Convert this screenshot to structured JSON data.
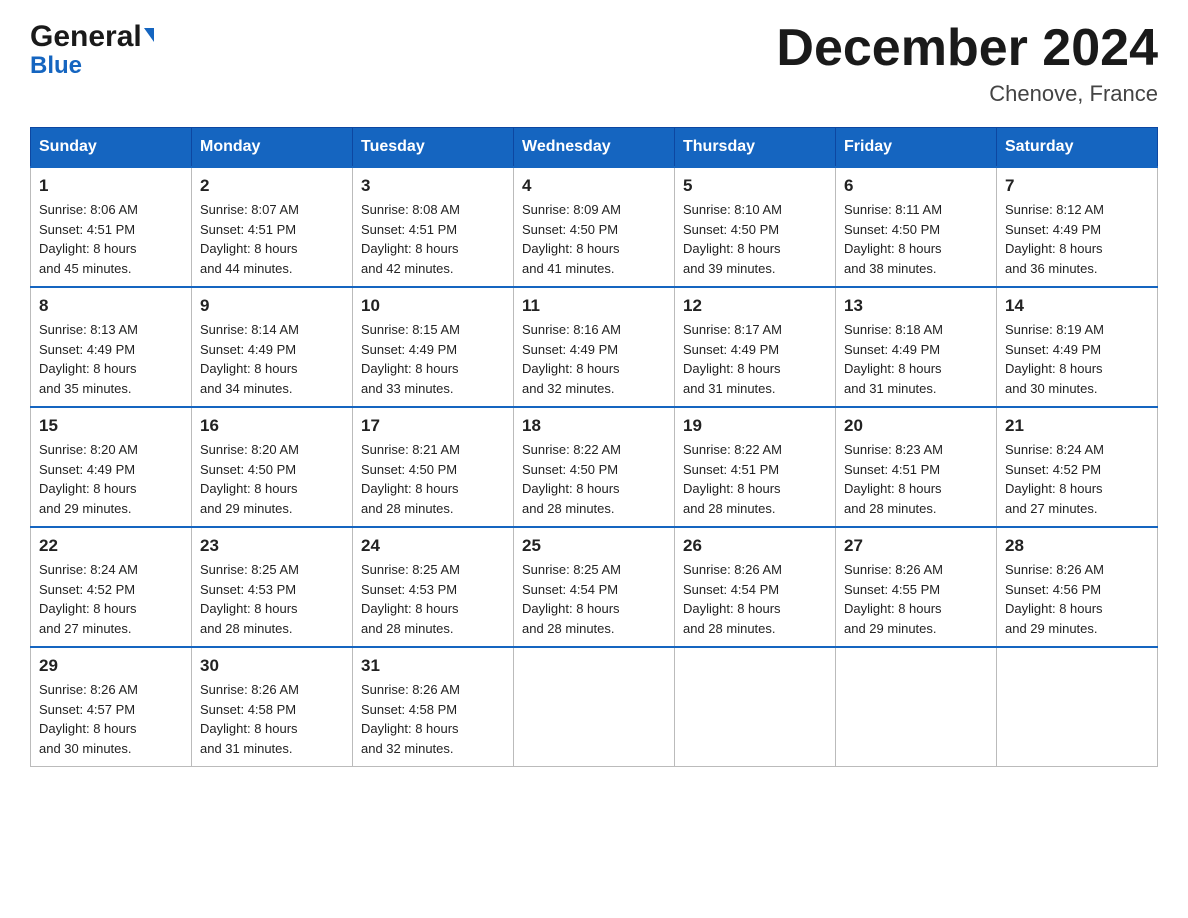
{
  "header": {
    "logo_general": "General",
    "logo_blue": "Blue",
    "month_title": "December 2024",
    "location": "Chenove, France"
  },
  "days_of_week": [
    "Sunday",
    "Monday",
    "Tuesday",
    "Wednesday",
    "Thursday",
    "Friday",
    "Saturday"
  ],
  "weeks": [
    [
      {
        "day": "1",
        "sunrise": "8:06 AM",
        "sunset": "4:51 PM",
        "daylight": "8 hours and 45 minutes."
      },
      {
        "day": "2",
        "sunrise": "8:07 AM",
        "sunset": "4:51 PM",
        "daylight": "8 hours and 44 minutes."
      },
      {
        "day": "3",
        "sunrise": "8:08 AM",
        "sunset": "4:51 PM",
        "daylight": "8 hours and 42 minutes."
      },
      {
        "day": "4",
        "sunrise": "8:09 AM",
        "sunset": "4:50 PM",
        "daylight": "8 hours and 41 minutes."
      },
      {
        "day": "5",
        "sunrise": "8:10 AM",
        "sunset": "4:50 PM",
        "daylight": "8 hours and 39 minutes."
      },
      {
        "day": "6",
        "sunrise": "8:11 AM",
        "sunset": "4:50 PM",
        "daylight": "8 hours and 38 minutes."
      },
      {
        "day": "7",
        "sunrise": "8:12 AM",
        "sunset": "4:49 PM",
        "daylight": "8 hours and 36 minutes."
      }
    ],
    [
      {
        "day": "8",
        "sunrise": "8:13 AM",
        "sunset": "4:49 PM",
        "daylight": "8 hours and 35 minutes."
      },
      {
        "day": "9",
        "sunrise": "8:14 AM",
        "sunset": "4:49 PM",
        "daylight": "8 hours and 34 minutes."
      },
      {
        "day": "10",
        "sunrise": "8:15 AM",
        "sunset": "4:49 PM",
        "daylight": "8 hours and 33 minutes."
      },
      {
        "day": "11",
        "sunrise": "8:16 AM",
        "sunset": "4:49 PM",
        "daylight": "8 hours and 32 minutes."
      },
      {
        "day": "12",
        "sunrise": "8:17 AM",
        "sunset": "4:49 PM",
        "daylight": "8 hours and 31 minutes."
      },
      {
        "day": "13",
        "sunrise": "8:18 AM",
        "sunset": "4:49 PM",
        "daylight": "8 hours and 31 minutes."
      },
      {
        "day": "14",
        "sunrise": "8:19 AM",
        "sunset": "4:49 PM",
        "daylight": "8 hours and 30 minutes."
      }
    ],
    [
      {
        "day": "15",
        "sunrise": "8:20 AM",
        "sunset": "4:49 PM",
        "daylight": "8 hours and 29 minutes."
      },
      {
        "day": "16",
        "sunrise": "8:20 AM",
        "sunset": "4:50 PM",
        "daylight": "8 hours and 29 minutes."
      },
      {
        "day": "17",
        "sunrise": "8:21 AM",
        "sunset": "4:50 PM",
        "daylight": "8 hours and 28 minutes."
      },
      {
        "day": "18",
        "sunrise": "8:22 AM",
        "sunset": "4:50 PM",
        "daylight": "8 hours and 28 minutes."
      },
      {
        "day": "19",
        "sunrise": "8:22 AM",
        "sunset": "4:51 PM",
        "daylight": "8 hours and 28 minutes."
      },
      {
        "day": "20",
        "sunrise": "8:23 AM",
        "sunset": "4:51 PM",
        "daylight": "8 hours and 28 minutes."
      },
      {
        "day": "21",
        "sunrise": "8:24 AM",
        "sunset": "4:52 PM",
        "daylight": "8 hours and 27 minutes."
      }
    ],
    [
      {
        "day": "22",
        "sunrise": "8:24 AM",
        "sunset": "4:52 PM",
        "daylight": "8 hours and 27 minutes."
      },
      {
        "day": "23",
        "sunrise": "8:25 AM",
        "sunset": "4:53 PM",
        "daylight": "8 hours and 28 minutes."
      },
      {
        "day": "24",
        "sunrise": "8:25 AM",
        "sunset": "4:53 PM",
        "daylight": "8 hours and 28 minutes."
      },
      {
        "day": "25",
        "sunrise": "8:25 AM",
        "sunset": "4:54 PM",
        "daylight": "8 hours and 28 minutes."
      },
      {
        "day": "26",
        "sunrise": "8:26 AM",
        "sunset": "4:54 PM",
        "daylight": "8 hours and 28 minutes."
      },
      {
        "day": "27",
        "sunrise": "8:26 AM",
        "sunset": "4:55 PM",
        "daylight": "8 hours and 29 minutes."
      },
      {
        "day": "28",
        "sunrise": "8:26 AM",
        "sunset": "4:56 PM",
        "daylight": "8 hours and 29 minutes."
      }
    ],
    [
      {
        "day": "29",
        "sunrise": "8:26 AM",
        "sunset": "4:57 PM",
        "daylight": "8 hours and 30 minutes."
      },
      {
        "day": "30",
        "sunrise": "8:26 AM",
        "sunset": "4:58 PM",
        "daylight": "8 hours and 31 minutes."
      },
      {
        "day": "31",
        "sunrise": "8:26 AM",
        "sunset": "4:58 PM",
        "daylight": "8 hours and 32 minutes."
      },
      null,
      null,
      null,
      null
    ]
  ],
  "labels": {
    "sunrise": "Sunrise: ",
    "sunset": "Sunset: ",
    "daylight": "Daylight: "
  }
}
